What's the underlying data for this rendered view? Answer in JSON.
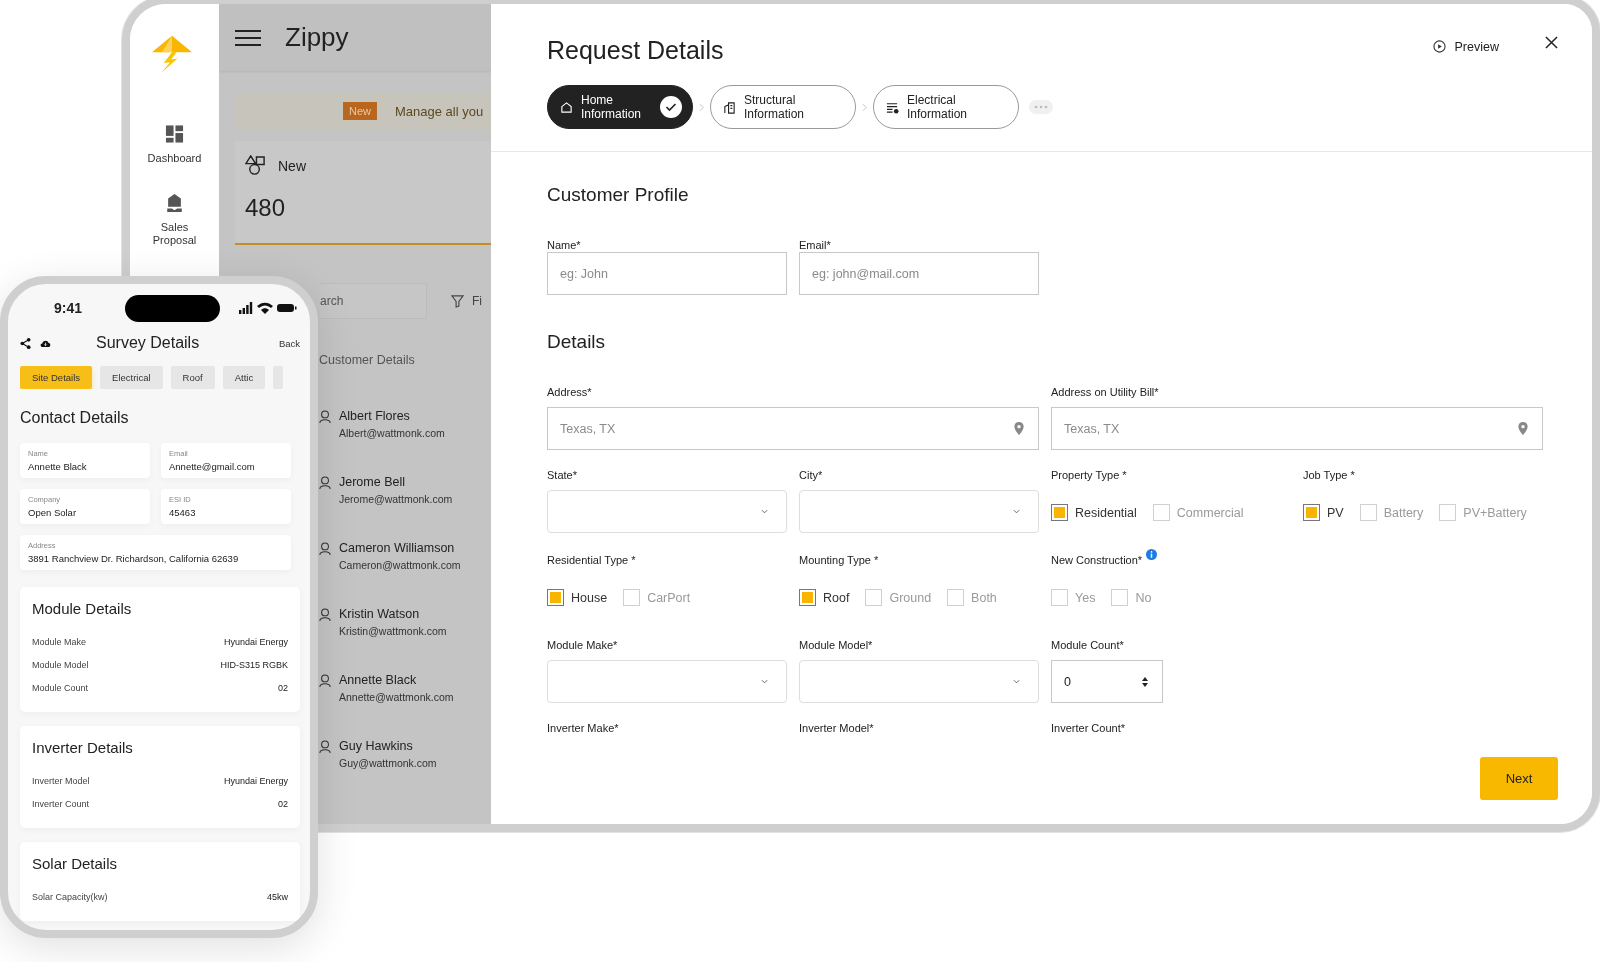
{
  "tablet": {
    "sidebar": {
      "items": [
        {
          "label": "Dashboard",
          "kind": "dashboard"
        },
        {
          "label": "Sales Proposal",
          "kind": "proposal"
        }
      ]
    },
    "app_title": "Zippy",
    "banner": {
      "badge": "New",
      "text": "Manage all you"
    },
    "stat_card": {
      "label": "New",
      "value": "480"
    },
    "search": {
      "placeholder": "arch"
    },
    "filter": {
      "label": "Fi"
    },
    "customers": {
      "title": "Customer Details",
      "items": [
        {
          "name": "Albert Flores",
          "email": "Albert@wattmonk.com"
        },
        {
          "name": "Jerome Bell",
          "email": "Jerome@wattmonk.com"
        },
        {
          "name": "Cameron Williamson",
          "email": "Cameron@wattmonk.com"
        },
        {
          "name": "Kristin Watson",
          "email": "Kristin@wattmonk.com"
        },
        {
          "name": "Annette Black",
          "email": "Annette@wattmonk.com"
        },
        {
          "name": "Guy Hawkins",
          "email": "Guy@wattmonk.com"
        }
      ]
    }
  },
  "modal": {
    "title": "Request Details",
    "preview": "Preview",
    "steps": [
      {
        "label": "Home Information",
        "kind": "home",
        "done": true
      },
      {
        "label": "Structural Information",
        "kind": "building",
        "done": false
      },
      {
        "label": "Electrical Information",
        "kind": "list",
        "done": false
      }
    ],
    "customer_profile": {
      "title": "Customer Profile",
      "fields": [
        {
          "label": "Name*",
          "placeholder": "eg: John"
        },
        {
          "label": "Email*",
          "placeholder": "eg: john@mail.com"
        }
      ]
    },
    "details": {
      "title": "Details",
      "rows": [
        {
          "fields": [
            {
              "label": "Address*",
              "kind": "location",
              "placeholder": "Texas, TX"
            },
            {
              "label": "Address on Utility Bill*",
              "kind": "location",
              "placeholder": "Texas, TX"
            }
          ]
        },
        {
          "fields": [
            {
              "label": "State*",
              "kind": "select"
            },
            {
              "label": "City*",
              "kind": "select"
            },
            {
              "label": "Property Type *",
              "kind": "checks",
              "options": [
                {
                  "label": "Residential",
                  "checked": true
                },
                {
                  "label": "Commercial",
                  "checked": false
                }
              ]
            },
            {
              "label": "Job Type *",
              "kind": "checks",
              "options": [
                {
                  "label": "PV",
                  "checked": true
                },
                {
                  "label": "Battery",
                  "checked": false
                },
                {
                  "label": "PV+Battery",
                  "checked": false
                }
              ]
            }
          ]
        },
        {
          "fields": [
            {
              "label": "Residential Type *",
              "kind": "checks",
              "options": [
                {
                  "label": "House",
                  "checked": true
                },
                {
                  "label": "CarPort",
                  "checked": false
                }
              ]
            },
            {
              "label": "Mounting Type *",
              "kind": "checks",
              "options": [
                {
                  "label": "Roof",
                  "checked": true
                },
                {
                  "label": "Ground",
                  "checked": false
                },
                {
                  "label": "Both",
                  "checked": false
                }
              ]
            },
            {
              "label": "New Construction*",
              "kind": "checks",
              "info": true,
              "options": [
                {
                  "label": "Yes",
                  "checked": false
                },
                {
                  "label": "No",
                  "checked": false
                }
              ]
            }
          ]
        },
        {
          "fields": [
            {
              "label": "Module Make*",
              "kind": "select"
            },
            {
              "label": "Module Model*",
              "kind": "select"
            },
            {
              "label": "Module Count*",
              "kind": "number",
              "value": "0"
            }
          ]
        },
        {
          "fields": [
            {
              "label": "Inverter Make*",
              "kind": "label"
            },
            {
              "label": "Inverter Model*",
              "kind": "label"
            },
            {
              "label": "Inverter Count*",
              "kind": "label"
            }
          ]
        }
      ]
    },
    "next": "Next"
  },
  "phone": {
    "time": "9:41",
    "title": "Survey Details",
    "back": "Back",
    "tabs": [
      {
        "label": "Site Details",
        "selected": true
      },
      {
        "label": "Electrical",
        "selected": false
      },
      {
        "label": "Roof",
        "selected": false
      },
      {
        "label": "Attic",
        "selected": false
      }
    ],
    "contact": {
      "title": "Contact Details",
      "fields": [
        {
          "label": "Name",
          "value": "Annette Black"
        },
        {
          "label": "Email",
          "value": "Annette@gmail.com"
        },
        {
          "label": "Company",
          "value": "Open Solar"
        },
        {
          "label": "ESI ID",
          "value": "45463"
        },
        {
          "label": "Address",
          "value": "3891 Ranchview Dr. Richardson, California 62639",
          "wide": true
        }
      ]
    },
    "cards": [
      {
        "title": "Module Details",
        "rows": [
          {
            "label": "Module Make",
            "value": "Hyundai Energy"
          },
          {
            "label": "Module Model",
            "value": "HID-S315 RGBK"
          },
          {
            "label": "Module Count",
            "value": "02"
          }
        ]
      },
      {
        "title": "Inverter Details",
        "rows": [
          {
            "label": "Inverter Model",
            "value": "Hyundai Energy"
          },
          {
            "label": "Inverter Count",
            "value": "02"
          }
        ]
      },
      {
        "title": "Solar Details",
        "rows": [
          {
            "label": "Solar Capacity(kw)",
            "value": "45kw"
          }
        ]
      }
    ]
  }
}
